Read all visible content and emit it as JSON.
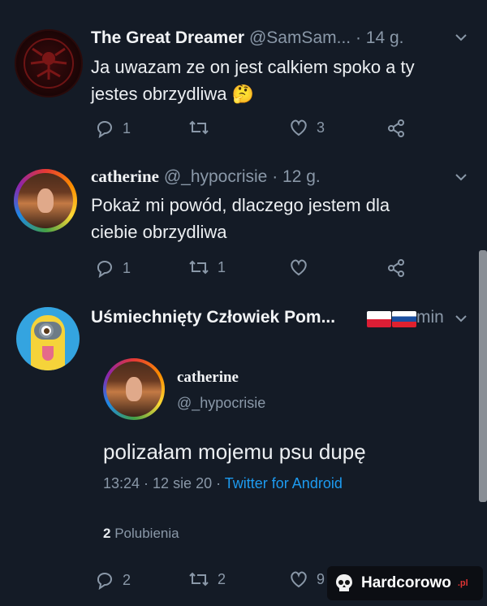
{
  "tweet1": {
    "name": "The Great Dreamer",
    "handle": "@SamSam...",
    "time": "· 14 g.",
    "text_line1": "Ja uwazam ze on jest calkiem spoko a ty",
    "text_line2": "jestes obrzydliwa",
    "emoji": "🤔",
    "replies": "1",
    "retweets": "",
    "likes": "3"
  },
  "tweet2": {
    "name": "catherine",
    "handle": "@_hypocrisie",
    "time": "· 12 g.",
    "text_line1": "Pokaż mi powód, dlaczego jestem dla",
    "text_line2": "ciebie obrzydliwa",
    "replies": "1",
    "retweets": "1",
    "likes": ""
  },
  "tweet3": {
    "name": "Uśmiechnięty Człowiek Pom...",
    "time": "min"
  },
  "quoted": {
    "name": "catherine",
    "handle": "@_hypocrisie",
    "text": "polizałam mojemu psu dupę",
    "meta_time": "13:24 · 12 sie 20 ·",
    "meta_source": "Twitter for Android",
    "likes_count": "2",
    "likes_label": "Polubienia",
    "replies": "2",
    "retweets": "2",
    "likes": "9"
  },
  "watermark": {
    "text": "Hardcorowo",
    "suffix": ".pl"
  }
}
